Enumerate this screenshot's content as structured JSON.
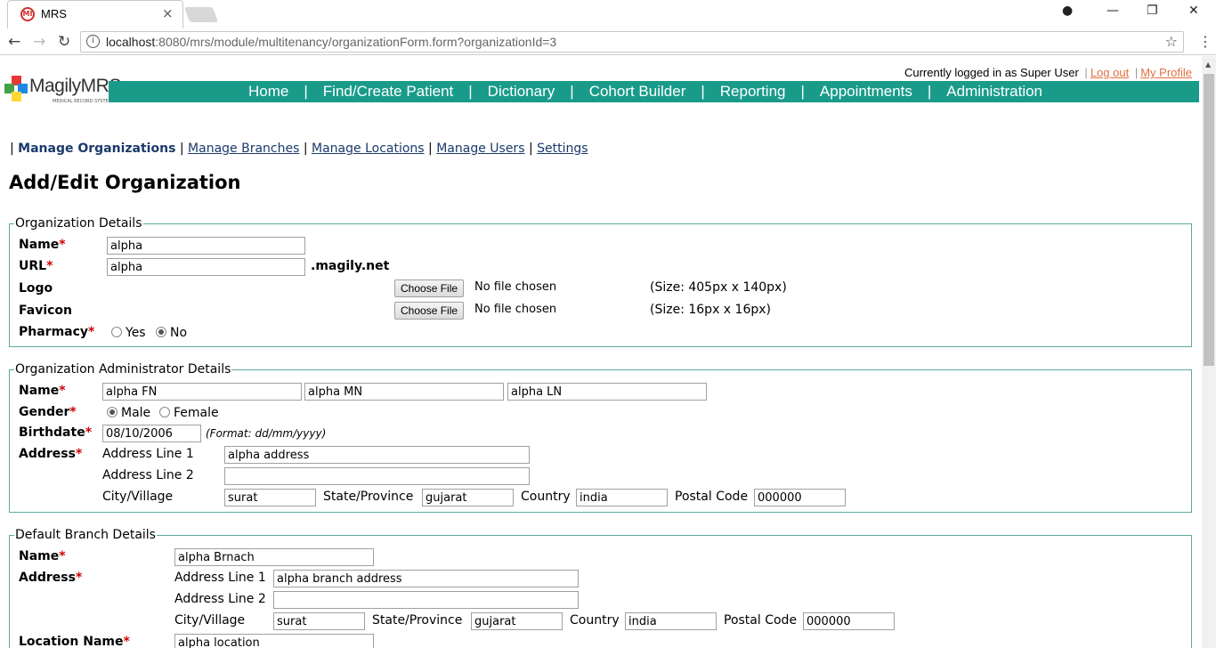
{
  "browser": {
    "tab_title": "MRS",
    "tab_close": "×",
    "favicon_text": "MI",
    "url_host": "localhost",
    "url_rest": ":8080/mrs/module/multitenancy/organizationForm.form?organizationId=3",
    "win_min": "—",
    "win_max": "❐",
    "win_close": "✕",
    "back": "←",
    "forward": "→",
    "reload": "↻",
    "star": "☆",
    "menu": "⋮",
    "info": "i"
  },
  "header": {
    "logo_text": "MagilyMRS",
    "logo_sub": "MEDICAL RECORD SYSTEM",
    "logged_in": "Currently logged in as Super User",
    "logout": "Log out",
    "profile": "My Profile",
    "nav": [
      "Home",
      "Find/Create Patient",
      "Dictionary",
      "Cohort Builder",
      "Reporting",
      "Appointments",
      "Administration"
    ]
  },
  "submenu": {
    "active": "Manage Organizations",
    "links": [
      "Manage Branches",
      "Manage Locations",
      "Manage Users",
      "Settings"
    ]
  },
  "page_title": "Add/Edit Organization",
  "org": {
    "legend": "Organization Details",
    "name_label": "Name",
    "name_value": "alpha",
    "url_label": "URL",
    "url_value": "alpha",
    "url_suffix": ".magily.net",
    "logo_label": "Logo",
    "favicon_label": "Favicon",
    "choose_file": "Choose File",
    "no_file": "No file chosen",
    "logo_size": "(Size: 405px x 140px)",
    "favicon_size": "(Size: 16px x 16px)",
    "pharmacy_label": "Pharmacy",
    "yes": "Yes",
    "no": "No",
    "pharmacy_selected": "No"
  },
  "admin": {
    "legend": "Organization Administrator Details",
    "name_label": "Name",
    "first": "alpha FN",
    "middle": "alpha MN",
    "last": "alpha LN",
    "gender_label": "Gender",
    "male": "Male",
    "female": "Female",
    "gender_selected": "Male",
    "birthdate_label": "Birthdate",
    "birthdate": "08/10/2006",
    "format_hint": "(Format: dd/mm/yyyy)",
    "address_label": "Address",
    "line1_label": "Address Line 1",
    "line1": "alpha address",
    "line2_label": "Address Line 2",
    "line2": "",
    "city_label": "City/Village",
    "city": "surat",
    "state_label": "State/Province",
    "state": "gujarat",
    "country_label": "Country",
    "country": "india",
    "postal_label": "Postal Code",
    "postal": "000000"
  },
  "branch": {
    "legend": "Default Branch Details",
    "name_label": "Name",
    "name": "alpha Brnach",
    "address_label": "Address",
    "line1_label": "Address Line 1",
    "line1": "alpha branch address",
    "line2_label": "Address Line 2",
    "line2": "",
    "city_label": "City/Village",
    "city": "surat",
    "state_label": "State/Province",
    "state": "gujarat",
    "country_label": "Country",
    "country": "india",
    "postal_label": "Postal Code",
    "postal": "000000",
    "location_label": "Location Name",
    "location": "alpha location"
  },
  "required_mark": "*"
}
